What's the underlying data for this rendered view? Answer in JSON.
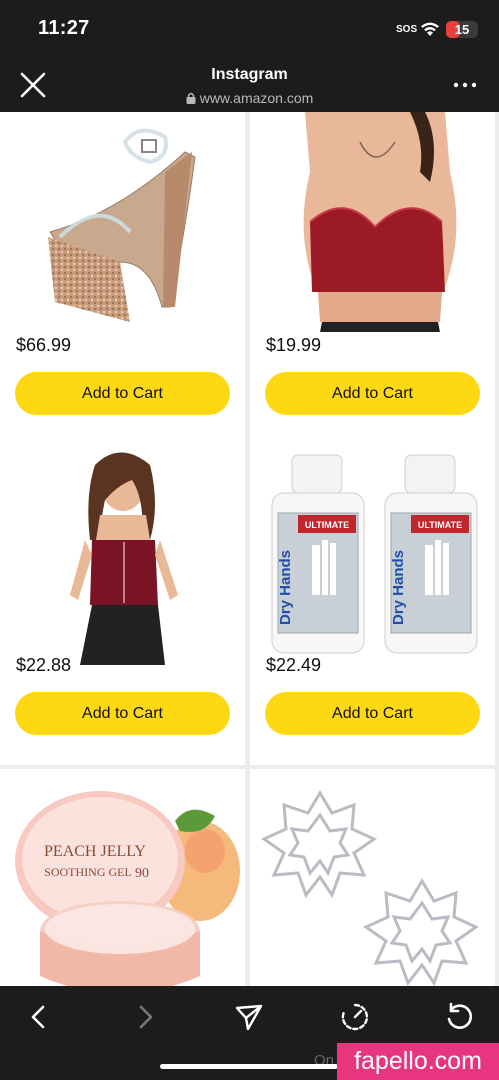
{
  "status_bar": {
    "time": "11:27",
    "sos": "SOS",
    "battery_level": "15",
    "battery_fraction": 0.15,
    "battery_color": "#e5403b"
  },
  "header": {
    "title": "Instagram",
    "url": "www.amazon.com",
    "close_icon": "close-icon",
    "lock_icon": "lock-icon",
    "more_icon": "more-horizontal-icon"
  },
  "products": [
    {
      "image": "platform-heel-sandal-image",
      "price": "$66.99",
      "button": "Add to Cart"
    },
    {
      "image": "red-satin-bralette-image",
      "price": "$19.99",
      "button": "Add to Cart"
    },
    {
      "image": "velvet-corset-top-image",
      "price": "$22.88",
      "button": "Add to Cart"
    },
    {
      "image": "dry-hands-grip-bottles-image",
      "price": "$22.49",
      "button": "Add to Cart"
    },
    {
      "image": "peach-jelly-gel-image",
      "price": "",
      "button": ""
    },
    {
      "image": "rhinestone-pasties-image",
      "price": "",
      "button": ""
    }
  ],
  "product_images_text": {
    "dry_hands_brand": "Dry Hands",
    "dry_hands_sub": "ULTIMATE",
    "peach_title": "PEACH JELLY",
    "peach_sub": "SOOTHING GEL",
    "peach_num": "90"
  },
  "toolbar": {
    "icons": [
      "back-icon",
      "forward-icon",
      "share-icon",
      "timer-icon",
      "reload-icon"
    ]
  },
  "overlay": {
    "watermark": "fapello.com",
    "ghost_text": "On"
  },
  "colors": {
    "button_yellow": "#ffd814",
    "page_bg": "#ececec",
    "chrome_bg": "#1c1c1c"
  }
}
